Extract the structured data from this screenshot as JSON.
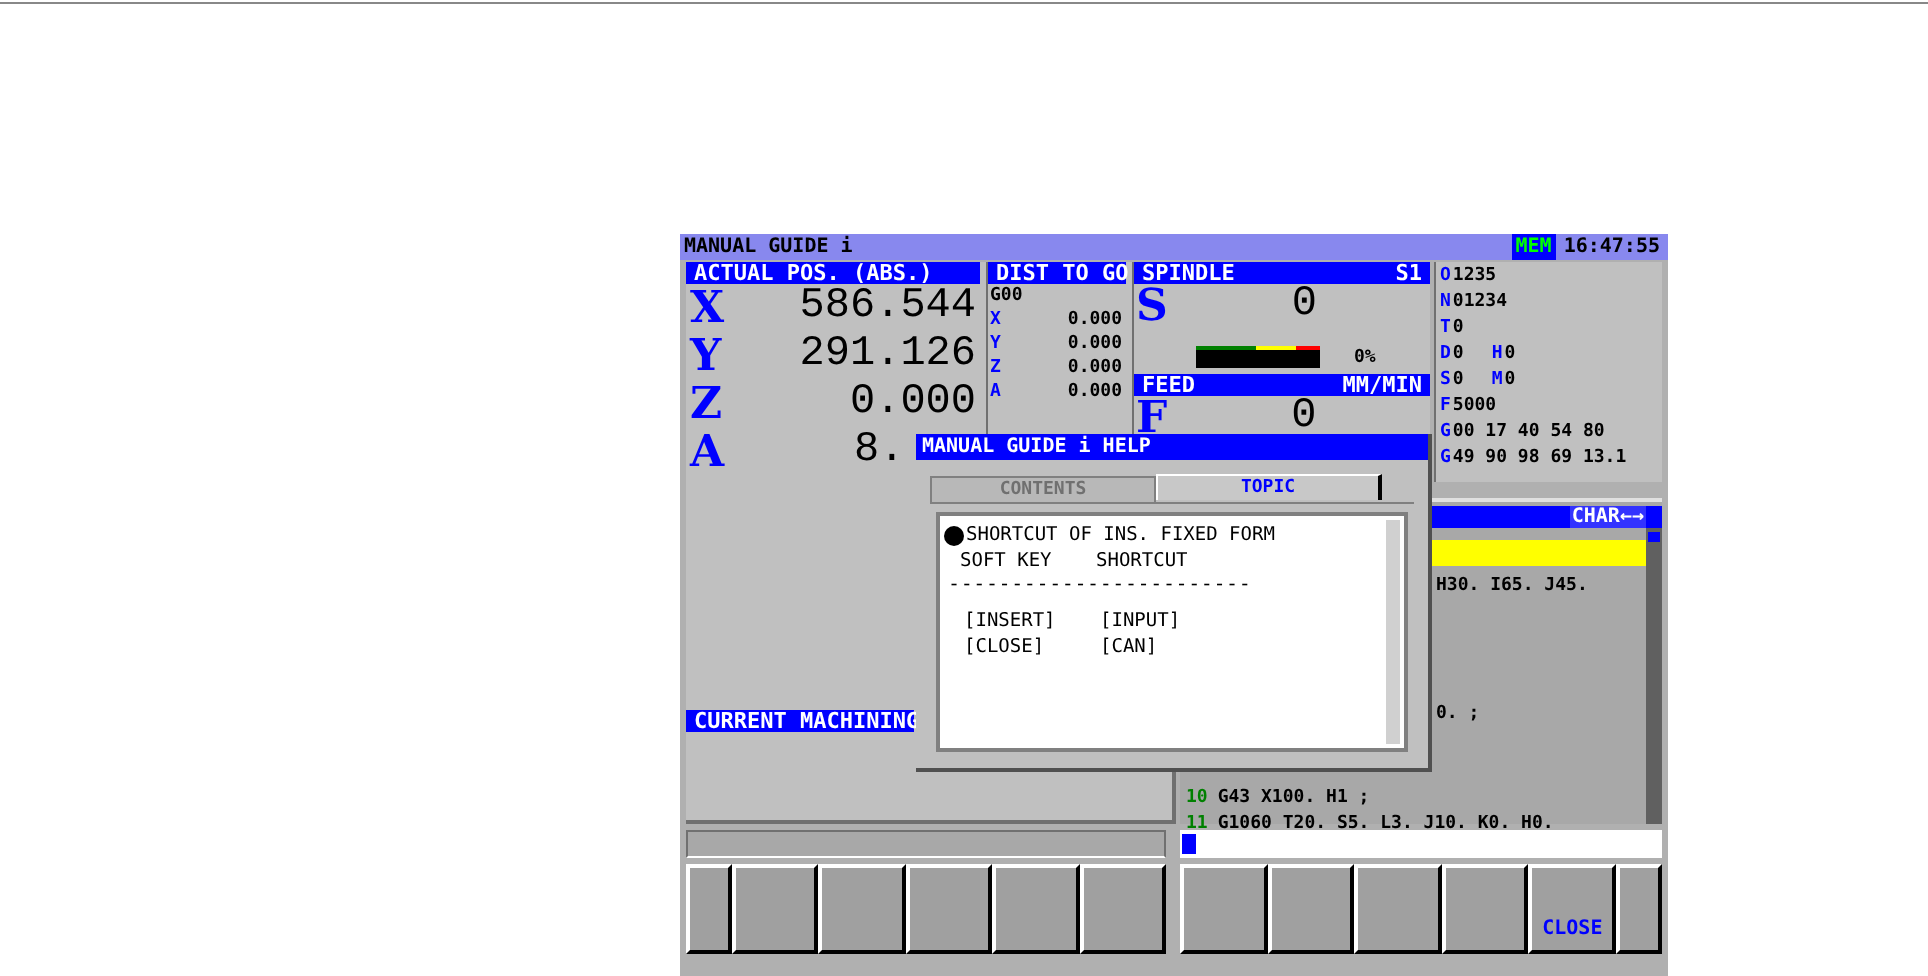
{
  "title_bar": {
    "title": "MANUAL GUIDE i",
    "mode": "MEM",
    "time": "16:47:55"
  },
  "actual_position": {
    "header": "ACTUAL POS. (ABS.)",
    "axes": [
      {
        "axis": "X",
        "value": "586.544"
      },
      {
        "axis": "Y",
        "value": "291.126"
      },
      {
        "axis": "Z",
        "value": "0.000"
      },
      {
        "axis": "A",
        "value": "8."
      }
    ]
  },
  "dist_to_go": {
    "header": "DIST TO GO",
    "mode": "G00",
    "axes": [
      {
        "axis": "X",
        "value": "0.000"
      },
      {
        "axis": "Y",
        "value": "0.000"
      },
      {
        "axis": "Z",
        "value": "0.000"
      },
      {
        "axis": "A",
        "value": "0.000"
      }
    ]
  },
  "spindle": {
    "header": "SPINDLE",
    "channel": "S1",
    "letter": "S",
    "value": "0",
    "load": "0%"
  },
  "feed": {
    "header": "FEED",
    "unit": "MM/MIN",
    "letter": "F",
    "value": "0"
  },
  "modal": [
    {
      "parts": [
        {
          "letter": "O",
          "value": "1235"
        }
      ]
    },
    {
      "parts": [
        {
          "letter": "N",
          "value": "01234"
        }
      ]
    },
    {
      "parts": [
        {
          "letter": "T",
          "value": "0"
        }
      ]
    },
    {
      "parts": [
        {
          "letter": "D",
          "value": "0"
        },
        {
          "letter": "H",
          "value": "0"
        }
      ]
    },
    {
      "parts": [
        {
          "letter": "S",
          "value": "0"
        },
        {
          "letter": "M",
          "value": "0"
        }
      ]
    },
    {
      "parts": [
        {
          "letter": "F",
          "value": "5000"
        }
      ]
    },
    {
      "parts": [
        {
          "letter": "G",
          "value": "00 17 40 54 80"
        }
      ]
    },
    {
      "parts": [
        {
          "letter": "G",
          "value": "49 90 98 69 13.1"
        }
      ]
    }
  ],
  "current_machining": {
    "header": "CURRENT MACHINING"
  },
  "program": {
    "header_right": "CHAR←→",
    "lines": [
      {
        "highlighted": true
      },
      {
        "highlighted": false,
        "text": "H30. I65. J45."
      },
      {
        "highlighted": false,
        "text": "0. ;"
      },
      {
        "highlighted": false,
        "number": "10",
        "text": "G43 X100. H1 ;"
      },
      {
        "highlighted": false,
        "number": "11",
        "text": "G1060 T20. S5. L3. J10. K0. H0."
      }
    ]
  },
  "help_dialog": {
    "title": "MANUAL GUIDE i HELP",
    "tabs": [
      {
        "label": "CONTENTS",
        "selected": false
      },
      {
        "label": "TOPIC",
        "selected": true
      }
    ],
    "heading": "SHORTCUT OF INS. FIXED FORM",
    "columns": [
      "SOFT KEY",
      "SHORTCUT"
    ],
    "separator": "------------------------",
    "rows": [
      [
        "[INSERT]",
        "[INPUT]"
      ],
      [
        "[CLOSE]",
        "[CAN]"
      ]
    ]
  },
  "soft_keys": [
    {
      "kind": "blank"
    },
    {
      "kind": "blank"
    },
    {
      "kind": "blank"
    },
    {
      "kind": "blank"
    },
    {
      "kind": "label",
      "label": "CLOSE"
    },
    {
      "kind": "blank"
    }
  ]
}
